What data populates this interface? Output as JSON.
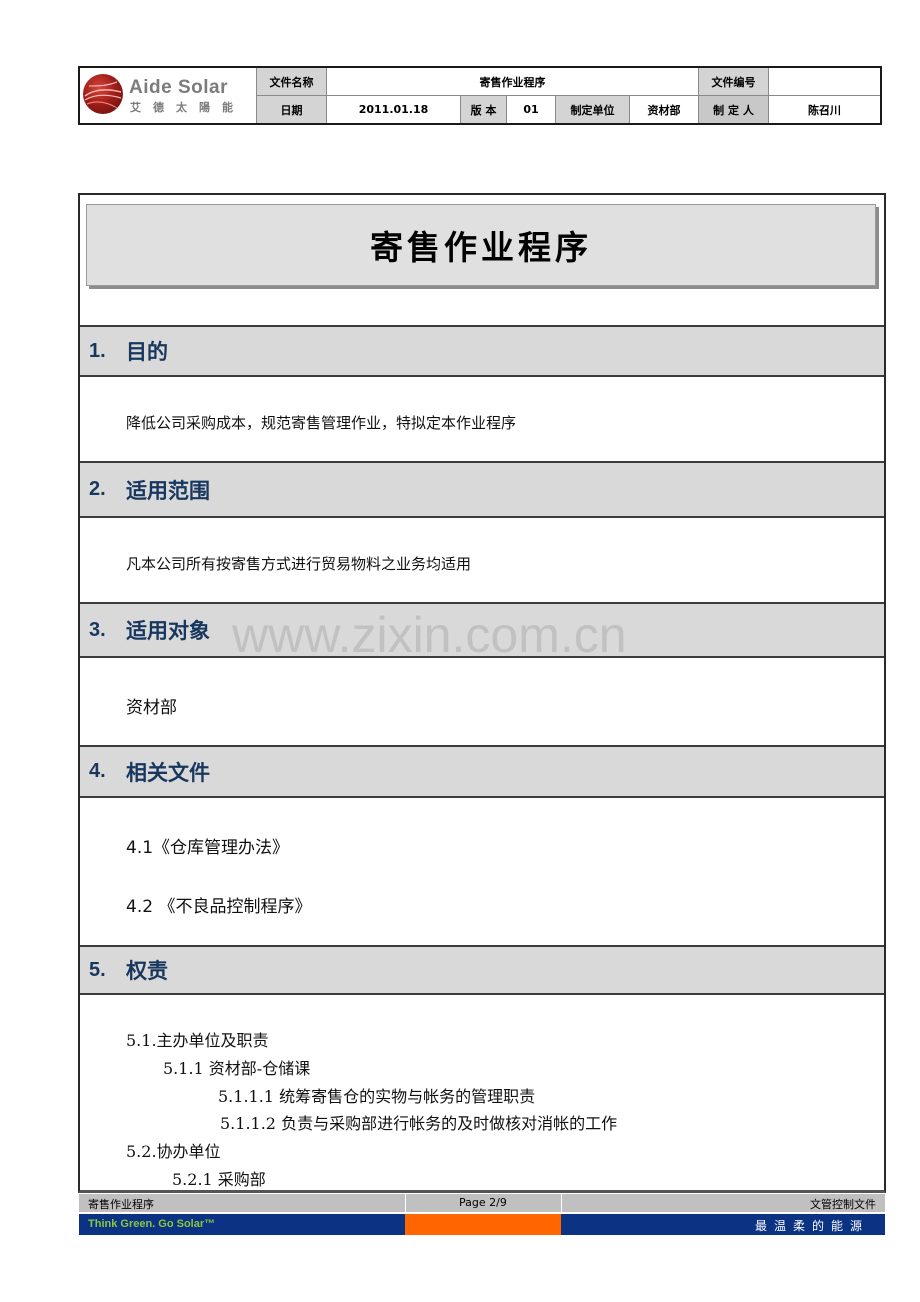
{
  "header": {
    "logo": {
      "brand": "Aide Solar",
      "brand_cn": "艾德太陽能",
      "icon": "aide-solar-logo-icon"
    },
    "doc_name_label": "文件名称",
    "doc_name": "寄售作业程序",
    "doc_no_label": "文件编号",
    "doc_no": "",
    "date_label": "日期",
    "date": "2011.01.18",
    "version_label": "版 本",
    "version": "01",
    "issuing_unit_label": "制定单位",
    "issuing_unit": "资材部",
    "author_label": "制 定 人",
    "author": "陈召川"
  },
  "document": {
    "title": "寄售作业程序",
    "sections": [
      {
        "num": "1.",
        "title": "目的",
        "content": [
          "降低公司采购成本，规范寄售管理作业，特拟定本作业程序"
        ]
      },
      {
        "num": "2.",
        "title": "适用范围",
        "content": [
          "凡本公司所有按寄售方式进行贸易物料之业务均适用"
        ]
      },
      {
        "num": "3.",
        "title": "适用对象",
        "content": [
          "资材部"
        ]
      },
      {
        "num": "4.",
        "title": "相关文件",
        "content": [
          "4.1《仓库管理办法》",
          "4.2 《不良品控制程序》"
        ]
      },
      {
        "num": "5.",
        "title": "权责",
        "content": [
          "5.1.主办单位及职责",
          "5.1.1 资材部-仓储课",
          "5.1.1.1 统筹寄售仓的实物与帐务的管理职责",
          "5.1.1.2 负责与采购部进行帐务的及时做核对消帐的工作",
          "5.2.协办单位",
          "5.2.1 采购部"
        ]
      }
    ]
  },
  "watermark": "www.zixin.com.cn",
  "footer": {
    "doc_name": "寄售作业程序",
    "page": "Page 2/9",
    "control": "文管控制文件",
    "slogan": "Think Green.   Go Solar™",
    "slogan_cn": "最温柔的能源",
    "colors": {
      "blue": "#0b3283",
      "orange": "#ff6600",
      "green": "#8cc63f",
      "heading": "#17375e"
    }
  }
}
